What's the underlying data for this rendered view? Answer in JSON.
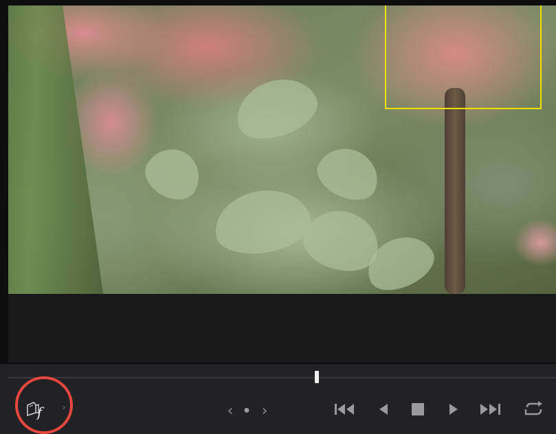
{
  "viewer": {
    "image_desc_icon": "flower-foliage-frame",
    "roi_color": "#f1e100"
  },
  "playback": {
    "scrub_position": 0.57
  },
  "controls": {
    "fx_icon": "camera-f-icon",
    "chevron": "›",
    "prev_keyframe": "‹",
    "next_keyframe": "›",
    "keyframe_dot": "●",
    "accent_ring_color": "#e8473f"
  }
}
